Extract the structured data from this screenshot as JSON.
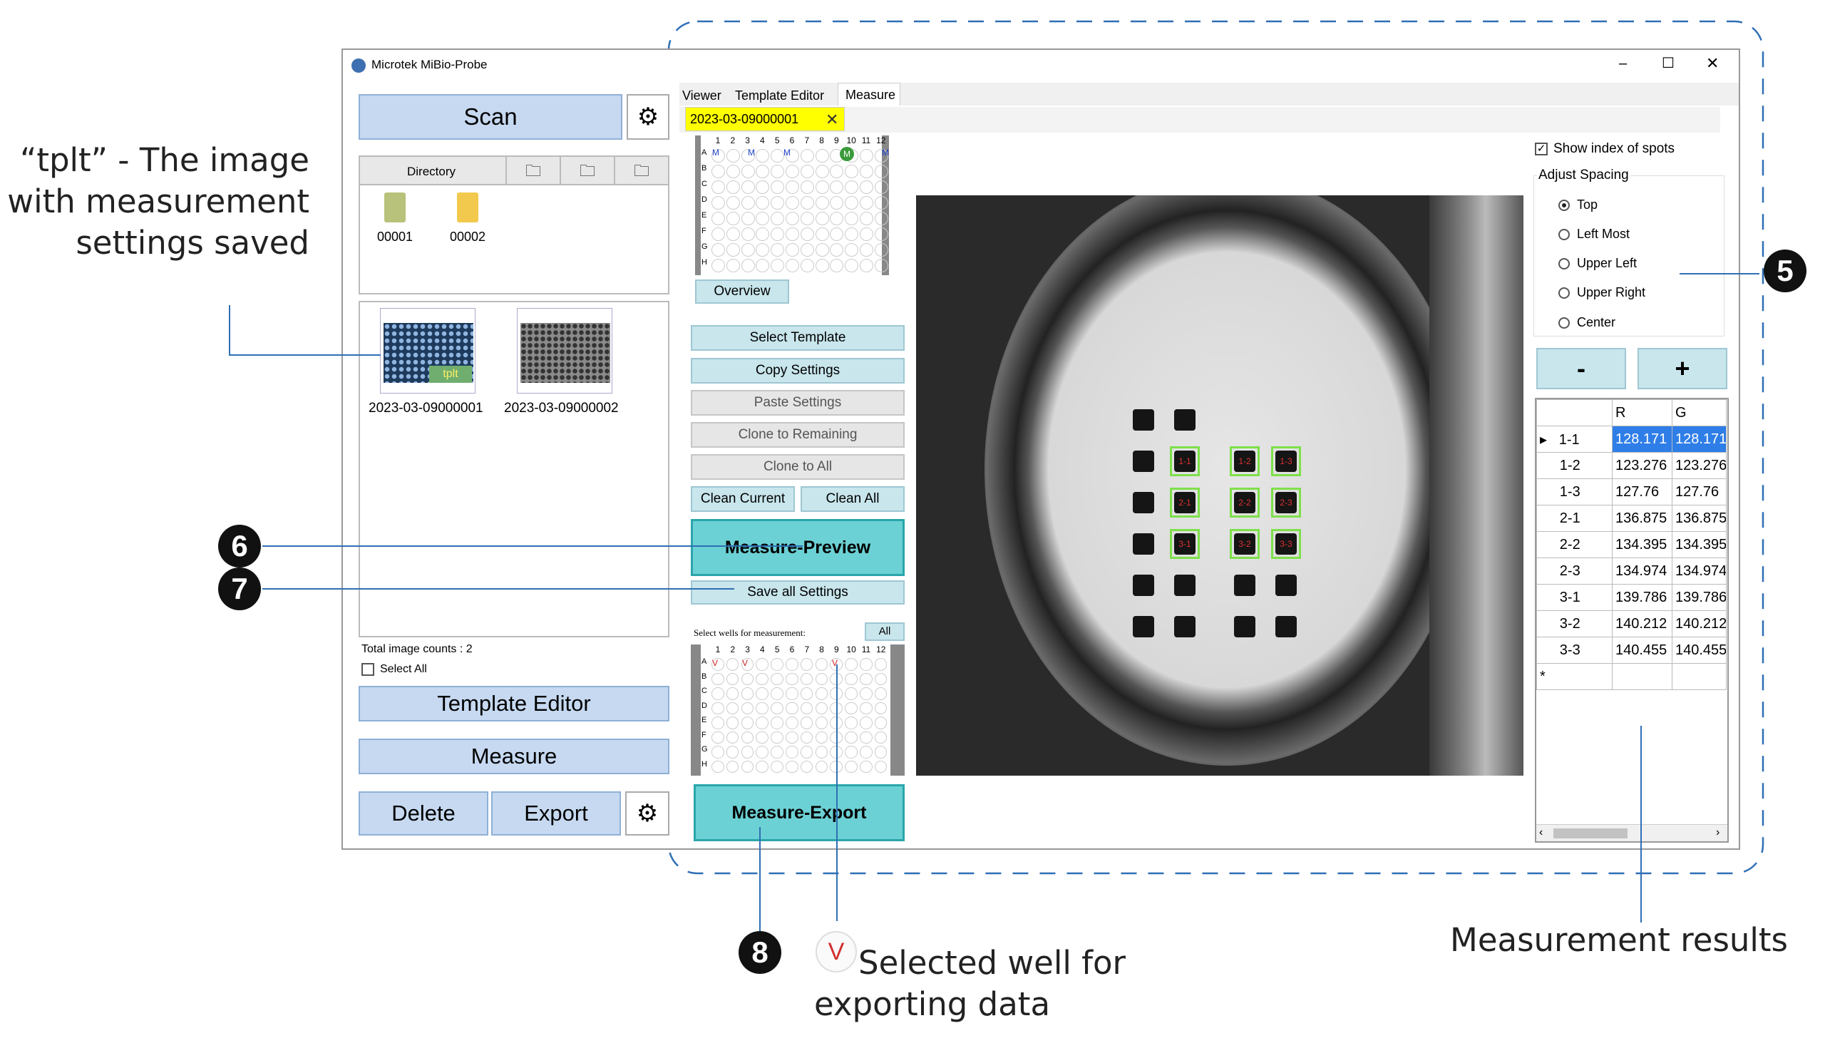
{
  "window": {
    "title": "Microtek MiBio-Probe",
    "minimize": "–",
    "maximize": "☐",
    "close": "✕"
  },
  "left": {
    "scan_label": "Scan",
    "directory_header": "Directory",
    "folders": [
      "00001",
      "00002"
    ],
    "images": [
      {
        "name": "2023-03-09000001",
        "badge": "tplt"
      },
      {
        "name": "2023-03-09000002",
        "badge": ""
      }
    ],
    "total_counts": "Total image counts : 2",
    "select_all": "Select All",
    "template_editor": "Template Editor",
    "measure": "Measure",
    "delete": "Delete",
    "export": "Export"
  },
  "tabs": [
    "Viewer",
    "Template Editor",
    "Measure"
  ],
  "doc_tab": {
    "label": "2023-03-09000001",
    "close": "✕"
  },
  "plate": {
    "cols": [
      "1",
      "2",
      "3",
      "4",
      "5",
      "6",
      "7",
      "8",
      "9",
      "10",
      "11",
      "12"
    ],
    "rows": [
      "A",
      "B",
      "C",
      "D",
      "E",
      "F",
      "G",
      "H"
    ],
    "top_marks": [
      "M",
      "M",
      "M",
      "M"
    ],
    "highlight": "M",
    "bottom_marks": [
      "V",
      "V",
      "V"
    ]
  },
  "mid": {
    "overview": "Overview",
    "select_template": "Select Template",
    "copy_settings": "Copy Settings",
    "paste_settings": "Paste Settings",
    "clone_remaining": "Clone to Remaining",
    "clone_all": "Clone to All",
    "clean_current": "Clean Current",
    "clean_all": "Clean All",
    "measure_preview": "Measure-Preview",
    "save_all": "Save all Settings",
    "select_wells": "Select wells for measurement:",
    "all": "All",
    "measure_export": "Measure-Export"
  },
  "spots": [
    "1-1",
    "1-2",
    "1-3",
    "2-1",
    "2-2",
    "2-3",
    "3-1",
    "3-2",
    "3-3"
  ],
  "right": {
    "show_index": "Show index of spots",
    "adjust_spacing": "Adjust Spacing",
    "options": [
      "Top",
      "Left Most",
      "Upper Left",
      "Upper Right",
      "Center"
    ],
    "selected_option": "Top",
    "minus": "-",
    "plus": "+",
    "columns": [
      "R",
      "G"
    ],
    "rows": [
      {
        "id": "1-1",
        "r": "128.171",
        "g": "128.171"
      },
      {
        "id": "1-2",
        "r": "123.276",
        "g": "123.276"
      },
      {
        "id": "1-3",
        "r": "127.76",
        "g": "127.76"
      },
      {
        "id": "2-1",
        "r": "136.875",
        "g": "136.875"
      },
      {
        "id": "2-2",
        "r": "134.395",
        "g": "134.395"
      },
      {
        "id": "2-3",
        "r": "134.974",
        "g": "134.974"
      },
      {
        "id": "3-1",
        "r": "139.786",
        "g": "139.786"
      },
      {
        "id": "3-2",
        "r": "140.212",
        "g": "140.212"
      },
      {
        "id": "3-3",
        "r": "140.455",
        "g": "140.455"
      }
    ],
    "new_row_marker": "*"
  },
  "annotations": {
    "tplt_line1": "“tplt” - The image",
    "tplt_line2": "with measurement",
    "tplt_line3": "settings saved",
    "n5": "5",
    "n6": "6",
    "n7": "7",
    "n8": "8",
    "v_icon": "V",
    "selected_well_line1": "Selected well for",
    "selected_well_line2": "exporting data",
    "measurement_results": "Measurement results"
  },
  "colors": {
    "blue_btn": "#c6d9f1",
    "teal_btn": "#6cd1d4",
    "selected_row": "#2f7ee8",
    "spot_box": "#7ee04a",
    "doc_tab": "#ffff00"
  }
}
